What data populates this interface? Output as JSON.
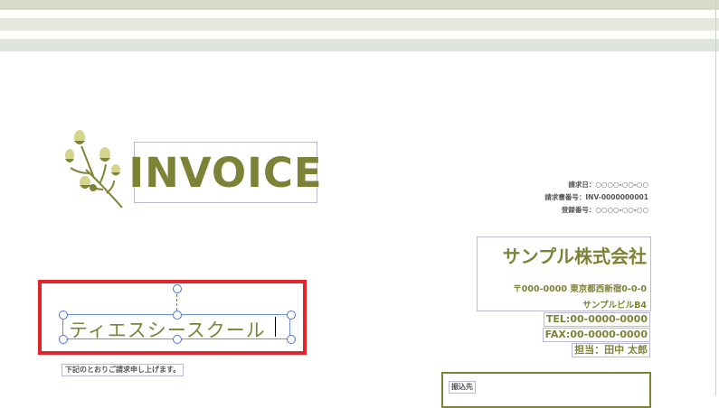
{
  "colors": {
    "accent": "#7d8336",
    "stripe_top": "#d8dcc6",
    "stripe_mid": "#e9e8df",
    "stripe_bottom": "#dce6df",
    "selection_red": "#e3252b",
    "handle_blue": "#4b78d6",
    "meta_gray": "#555555"
  },
  "header": {
    "title": "INVOICE"
  },
  "meta": {
    "issue_date": "請求日：○○○○-○○-○○",
    "invoice_number": "請求書番号：INV-0000000001",
    "registration_number": "登録番号：○○○○-○○-○○"
  },
  "company": {
    "name": "サンプル株式会社",
    "address_line1": "〒000-0000 東京都西新宿0-0-0",
    "address_line2": "サンプルビルB4",
    "tel": "TEL:00-0000-0000",
    "fax": "FAX:00-0000-0000",
    "contact": "担当：田中 太郎"
  },
  "recipient": {
    "textbox_value": "ティエスシースクール"
  },
  "note": {
    "text": "下記のとおりご請求申し上げます。"
  },
  "bank": {
    "label": "振込先"
  },
  "icons": {
    "logo": "flower-branch-icon"
  }
}
